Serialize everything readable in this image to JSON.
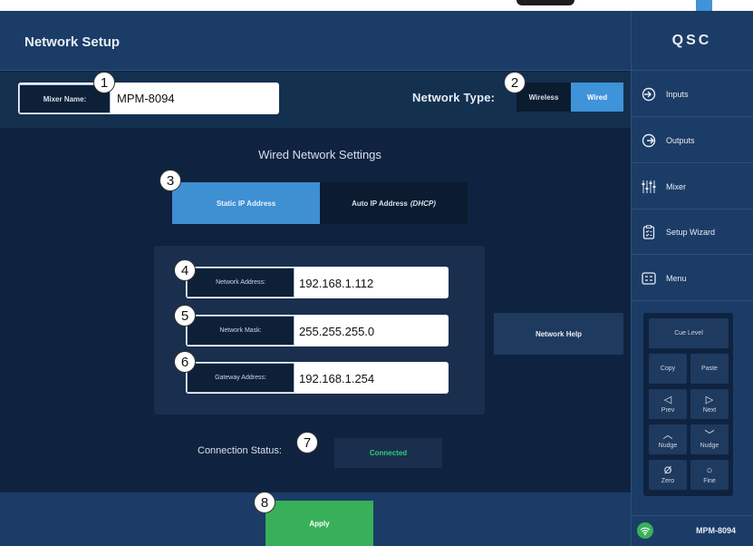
{
  "header": {
    "title": "Network Setup",
    "logo": "QSC"
  },
  "mixer_name": {
    "label": "Mixer Name:",
    "value": "MPM-8094"
  },
  "network_type": {
    "label": "Network Type:",
    "options": [
      "Wireless",
      "Wired"
    ],
    "selected": "Wired"
  },
  "wired_settings": {
    "title": "Wired Network Settings",
    "tabs": {
      "static": "Static IP Address",
      "auto": "Auto IP Address",
      "auto_suffix": "(DHCP)"
    },
    "selected_tab": "Static IP Address",
    "fields": [
      {
        "label": "Network Address:",
        "value": "192.168.1.112"
      },
      {
        "label": "Network Mask:",
        "value": "255.255.255.0"
      },
      {
        "label": "Gateway Address:",
        "value": "192.168.1.254"
      }
    ],
    "help_button": "Network Help"
  },
  "connection": {
    "label": "Connection Status:",
    "value": "Connected"
  },
  "apply_button": "Apply",
  "callouts": [
    "1",
    "2",
    "3",
    "4",
    "5",
    "6",
    "7",
    "8"
  ],
  "sidebar": {
    "items": [
      {
        "label": "Inputs",
        "icon": "inputs-icon"
      },
      {
        "label": "Outputs",
        "icon": "outputs-icon"
      },
      {
        "label": "Mixer",
        "icon": "faders-icon"
      },
      {
        "label": "Setup Wizard",
        "icon": "clipboard-icon"
      },
      {
        "label": "Menu",
        "icon": "menu-icon"
      }
    ],
    "keypad": {
      "cue_level": "Cue Level",
      "copy": "Copy",
      "paste": "Paste",
      "prev": "Prev",
      "next": "Next",
      "nudge_up": "Nudge",
      "nudge_down": "Nudge",
      "zero": "Zero",
      "fine": "Fine"
    },
    "device_name": "MPM-8094"
  },
  "colors": {
    "accent": "#3f93d8",
    "apply": "#38b05a",
    "connected": "#2ecf7a",
    "background": "#0f2340"
  }
}
